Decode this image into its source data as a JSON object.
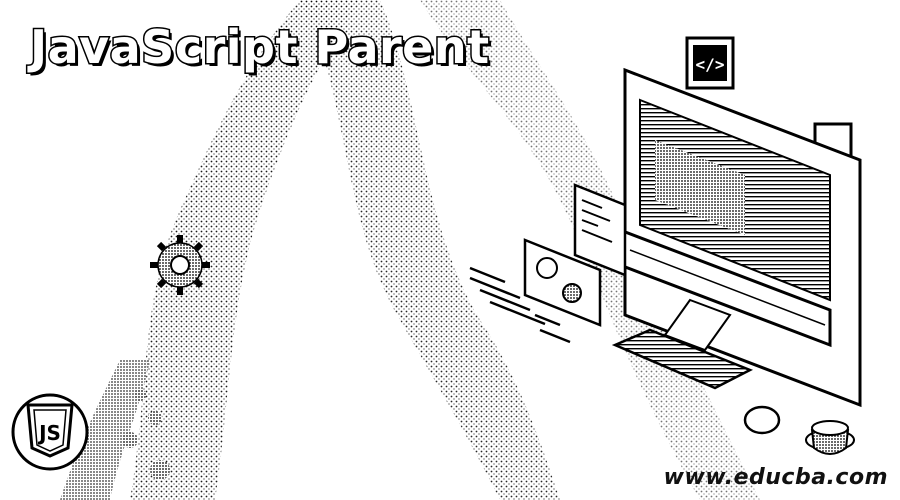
{
  "banner": {
    "title": "JavaScript Parent",
    "website": "www.educba.com",
    "js_logo_text": "JS",
    "code_badge_text": "</>"
  },
  "colors": {
    "background": "#ffffff",
    "ink": "#000000"
  },
  "icons": [
    "js-shield-icon",
    "code-tag-icon",
    "gear-icon",
    "computer-monitor-icon",
    "keyboard-icon",
    "mouse-icon",
    "coffee-cup-icon"
  ]
}
